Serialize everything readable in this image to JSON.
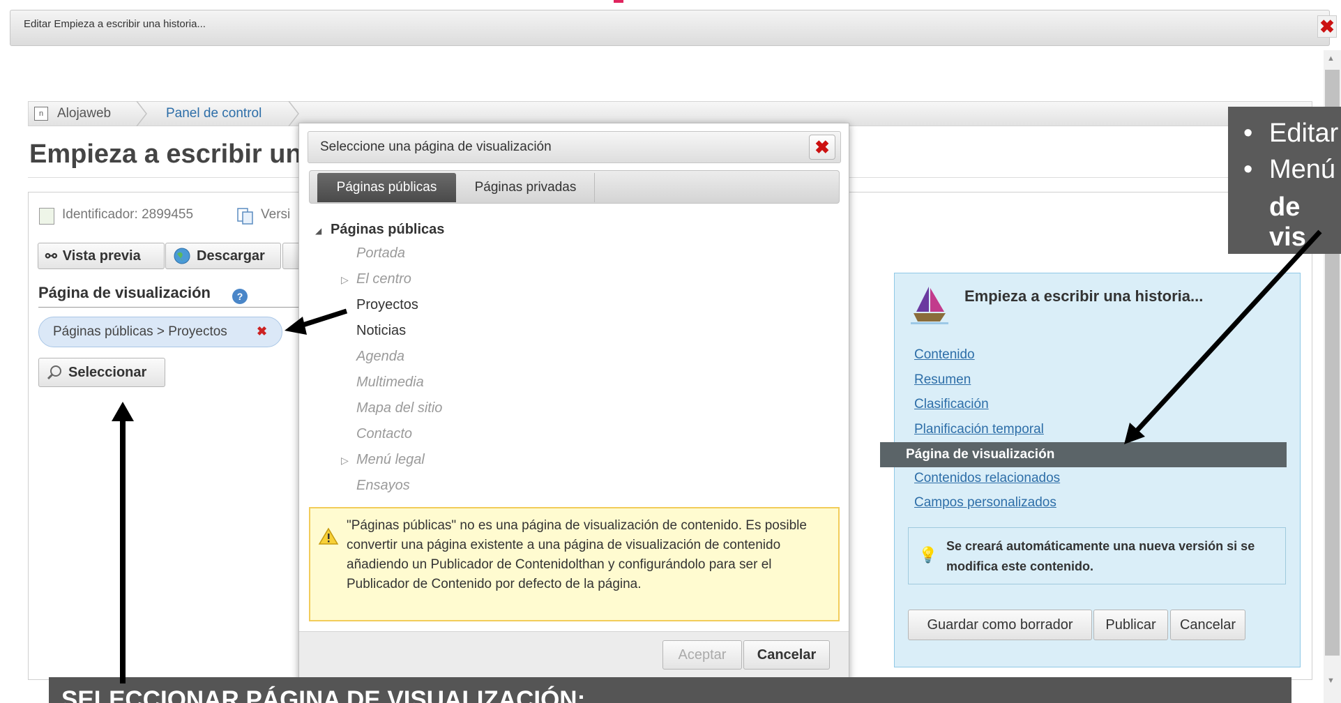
{
  "window": {
    "title": "Editar Empieza a escribir una historia..."
  },
  "breadcrumb": {
    "items": [
      "Alojaweb",
      "Panel de control"
    ]
  },
  "page": {
    "title": "Empieza a escribir un"
  },
  "meta": {
    "identifier": "Identificador: 2899455",
    "version": "Versi"
  },
  "toolbar": {
    "preview": "Vista previa",
    "download": "Descargar"
  },
  "display_page": {
    "label": "Página de visualización",
    "selected_chip": "Páginas públicas > Proyectos",
    "select_button": "Seleccionar"
  },
  "dialog": {
    "title": "Seleccione una página de visualización",
    "tabs": [
      "Páginas públicas",
      "Páginas privadas"
    ],
    "tree": {
      "root": "Páginas públicas",
      "items": [
        {
          "label": "Portada",
          "state": "dim",
          "expandable": false
        },
        {
          "label": "El centro",
          "state": "dim",
          "expandable": true
        },
        {
          "label": "Proyectos",
          "state": "active",
          "expandable": false
        },
        {
          "label": "Noticias",
          "state": "active",
          "expandable": false
        },
        {
          "label": "Agenda",
          "state": "dim",
          "expandable": false
        },
        {
          "label": "Multimedia",
          "state": "dim",
          "expandable": false
        },
        {
          "label": "Mapa del sitio",
          "state": "dim",
          "expandable": false
        },
        {
          "label": "Contacto",
          "state": "dim",
          "expandable": false
        },
        {
          "label": "Menú legal",
          "state": "dim",
          "expandable": true
        },
        {
          "label": "Ensayos",
          "state": "dim",
          "expandable": false
        }
      ]
    },
    "warning": "\"Páginas públicas\" no es una página de visualización de contenido. Es posible convertir una página existente a una página de visualización de contenido añadiendo un Publicador de Contenidolthan y configurándolo para ser el Publicador de Contenido por defecto de la página.",
    "accept": "Aceptar",
    "cancel": "Cancelar"
  },
  "info_panel": {
    "title": "Empieza a escribir una historia...",
    "links": [
      "Contenido",
      "Resumen",
      "Clasificación",
      "Planificación temporal"
    ],
    "selected": "Página de visualización",
    "links_after": [
      "Contenidos relacionados",
      "Campos personalizados"
    ],
    "notice": "Se creará automáticamente una nueva versión si se modifica este contenido.",
    "buttons": {
      "draft": "Guardar como borrador",
      "publish": "Publicar",
      "cancel": "Cancelar"
    }
  },
  "callouts": {
    "top_lines": [
      "Editar",
      "Menú",
      "de vis"
    ],
    "bottom": "SELECCIONAR PÁGINA DE VISUALIZACIÓN:"
  },
  "colors": {
    "accent_link": "#2d6ea8",
    "dialog_close": "#cc1111",
    "info_bg": "#daeef8",
    "warning_bg": "#fffbd0"
  }
}
